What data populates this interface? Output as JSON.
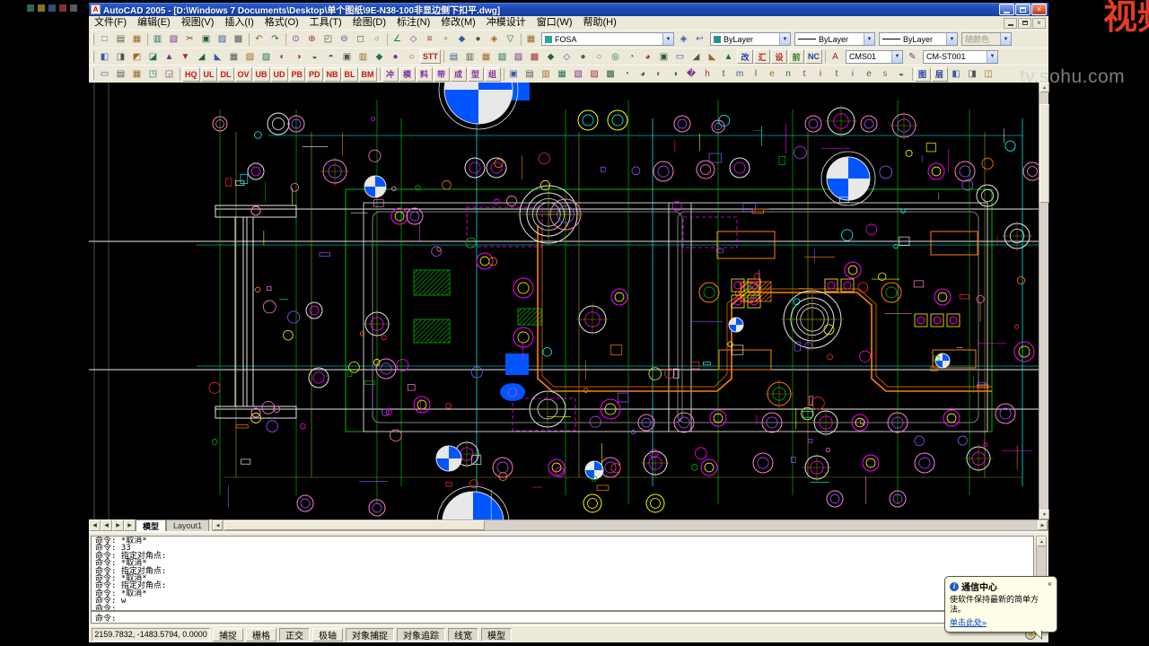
{
  "window": {
    "title": "AutoCAD 2005 - [D:\\Windows 7 Documents\\Desktop\\单个图纸\\9E-N38-100非显边侧下扣平.dwg]"
  },
  "menubar": {
    "items": [
      "文件(F)",
      "编辑(E)",
      "视图(V)",
      "插入(I)",
      "格式(O)",
      "工具(T)",
      "绘图(D)",
      "标注(N)",
      "修改(M)",
      "冲模设计",
      "窗口(W)",
      "帮助(H)"
    ]
  },
  "toolbar1": {
    "icons": "□▤▦|▥▧✂▣▨▩|↶↷|⊙⊕◰⊖◻○|∠◇≡▫◆●◈▽",
    "layer_combo": "FOSA",
    "layer_swatch": "#00b8b8",
    "color_combo": "ByLayer",
    "color_swatch": "#00a0a0",
    "linetype_combo": "ByLayer",
    "lineweight_combo": "ByLayer",
    "plotstyle_combo": "随颜色"
  },
  "toolbar2": {
    "icons_a": "◧◨◩◪▲▼◢◣▦▧▨◐◑◒◓▣▥◆●○",
    "button_a": "STT",
    "icons_b": "▤▥▦▧▨▩◆◇●○◎◔◕▣▭◢◣▲",
    "buttons_b": [
      {
        "g": "改",
        "c": "#2040a0"
      },
      {
        "g": "汇",
        "c": "#c02020"
      },
      {
        "g": "设",
        "c": "#c02020"
      },
      {
        "g": "前",
        "c": "#208020"
      },
      {
        "g": "NC",
        "c": "#2040a0"
      }
    ],
    "style_label": "A",
    "style_combo": "CMS01",
    "dim_icon": "✎",
    "dimstyle_combo": "CM-ST001"
  },
  "toolbar3": {
    "icons_a": "▭▤▦◳◲",
    "buttons_a": [
      "HQ",
      "UL",
      "DL",
      "OV",
      "UB",
      "UD",
      "PB",
      "PD",
      "NB",
      "BL",
      "BM"
    ],
    "buttons_b": [
      "冲",
      "模",
      "料",
      "带",
      "成",
      "型",
      "组"
    ],
    "icons_b": "▣▤▥▦▧▨▩◔◕◐◑�htmlentities◒",
    "buttons_c": [
      "图",
      "层"
    ],
    "icons_c": "◧◨◫"
  },
  "tabs": {
    "nav": [
      "◀",
      "◀",
      "▶",
      "▶"
    ],
    "model": "模型",
    "layout1": "Layout1"
  },
  "command": {
    "history": [
      "命令: *取消*",
      "命令: 33",
      "命令: 指定对角点:",
      "命令: *取消*",
      "命令: 指定对角点:",
      "命令: *取消*",
      "命令: 指定对角点:",
      "命令: *取消*",
      "命令: w",
      "命令:"
    ],
    "prompt": "命令:"
  },
  "statusbar": {
    "coords": "2159.7832, -1483.5794, 0.0000",
    "toggles": [
      {
        "label": "捕捉",
        "pressed": false
      },
      {
        "label": "栅格",
        "pressed": false
      },
      {
        "label": "正交",
        "pressed": true
      },
      {
        "label": "极轴",
        "pressed": false
      },
      {
        "label": "对象捕捉",
        "pressed": true
      },
      {
        "label": "对象追踪",
        "pressed": true
      },
      {
        "label": "线宽",
        "pressed": true
      },
      {
        "label": "模型",
        "pressed": true
      }
    ]
  },
  "comm_center": {
    "title": "通信中心",
    "body": "使软件保持最新的简单方法。",
    "link": "单击此处»",
    "close": "×"
  },
  "watermarks": {
    "sohu": "tv.sohu.com",
    "logo": "视频"
  },
  "drawing": {
    "palette": {
      "bg": "#000000",
      "white": "#e6e6e6",
      "magenta": "#ff00ff",
      "yellow": "#ffff00",
      "cyan": "#00ffff",
      "green": "#00b400",
      "orange": "#ff8000",
      "blue": "#0055ff",
      "red": "#ff2a2a",
      "pink": "#ff7ec8",
      "purple": "#a050ff",
      "olive": "#8f8f00",
      "gray": "#909090"
    }
  }
}
